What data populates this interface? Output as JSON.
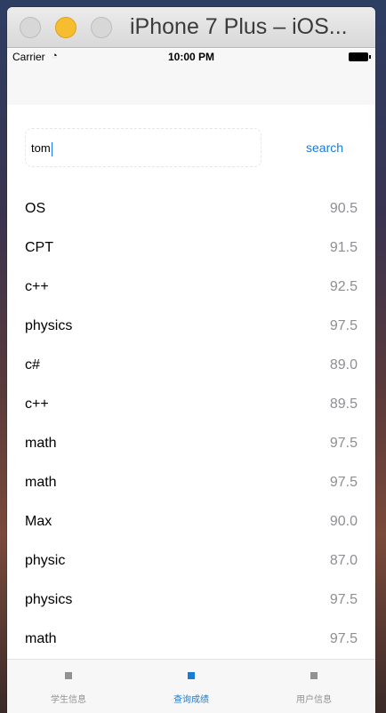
{
  "window": {
    "title": "iPhone 7 Plus – iOS..."
  },
  "status_bar": {
    "carrier": "Carrier",
    "wifi_icon": "wifi-icon",
    "time": "10:00 PM",
    "battery_icon": "battery-icon"
  },
  "search": {
    "value": "tom",
    "button_label": "search"
  },
  "results": [
    {
      "name": "OS",
      "score": "90.5"
    },
    {
      "name": "CPT",
      "score": "91.5"
    },
    {
      "name": "c++",
      "score": "92.5"
    },
    {
      "name": "physics",
      "score": "97.5"
    },
    {
      "name": "c#",
      "score": "89.0"
    },
    {
      "name": "c++",
      "score": "89.5"
    },
    {
      "name": "math",
      "score": "97.5"
    },
    {
      "name": "math",
      "score": "97.5"
    },
    {
      "name": "Max",
      "score": "90.0"
    },
    {
      "name": "physic",
      "score": "87.0"
    },
    {
      "name": "physics",
      "score": "97.5"
    },
    {
      "name": "math",
      "score": "97.5"
    }
  ],
  "tabbar": {
    "tabs": [
      {
        "label": "学生信息",
        "active": false
      },
      {
        "label": "查询成绩",
        "active": true
      },
      {
        "label": "用户信息",
        "active": false
      }
    ]
  },
  "colors": {
    "accent": "#1a7ad9",
    "inactive": "#929292",
    "window_min": "#f6be2f"
  }
}
